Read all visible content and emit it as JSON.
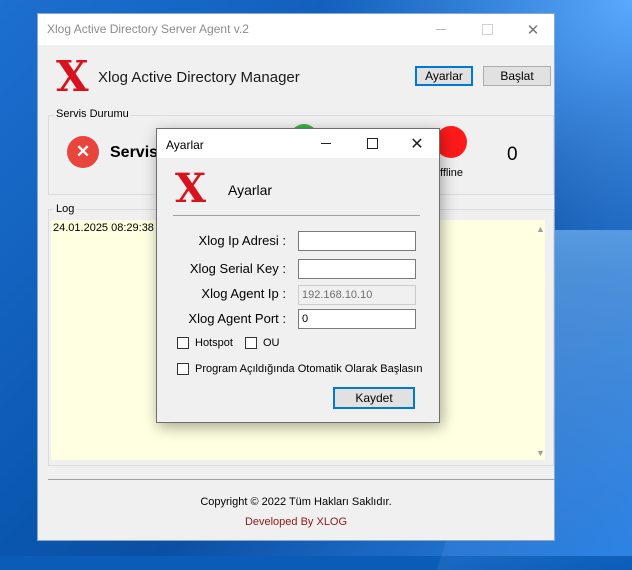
{
  "main_window": {
    "title": "Xlog Active Directory Server Agent v.2",
    "logo_letter": "X",
    "app_title": "Xlog Active Directory Manager",
    "buttons": {
      "settings": "Ayarlar",
      "start": "Başlat"
    },
    "service_group": {
      "label": "Servis Durumu",
      "status_text": "Servis",
      "offline_label": "ffline",
      "count": "0",
      "colors": {
        "stopped": "#e8453c",
        "online": "#3cb043",
        "offline": "#ff1a1a"
      }
    },
    "log_group": {
      "label": "Log",
      "entry": "24.01.2025 08:29:38"
    },
    "footer": {
      "copyright": "Copyright © 2022 Tüm Hakları Saklıdır.",
      "developed": "Developed By XLOG"
    }
  },
  "settings_dialog": {
    "title": "Ayarlar",
    "logo_letter": "X",
    "heading": "Ayarlar",
    "fields": {
      "ip_label": "Xlog Ip Adresi :",
      "ip_value": "",
      "serial_label": "Xlog Serial Key :",
      "serial_value": "",
      "agent_ip_label": "Xlog Agent Ip :",
      "agent_ip_value": "192.168.10.10",
      "agent_port_label": "Xlog Agent Port :",
      "agent_port_value": "0"
    },
    "checkboxes": {
      "hotspot": "Hotspot",
      "ou": "OU",
      "autostart": "Program Açıldığında Otomatik Olarak Başlasın"
    },
    "save_label": "Kaydet"
  },
  "colors": {
    "brand_red": "#d7141d",
    "accent_blue": "#0078d7",
    "log_bg": "#ffffe1"
  }
}
